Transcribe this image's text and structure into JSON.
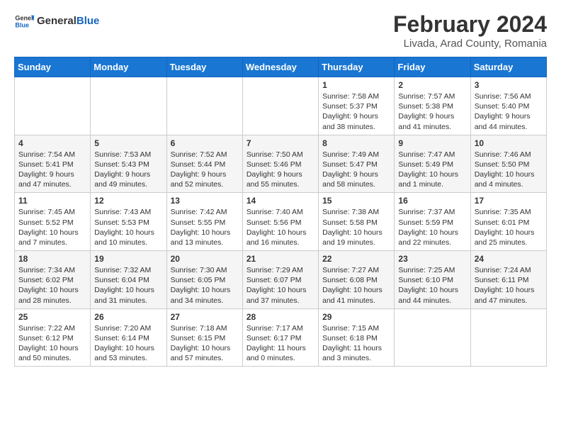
{
  "header": {
    "logo_general": "General",
    "logo_blue": "Blue",
    "main_title": "February 2024",
    "subtitle": "Livada, Arad County, Romania"
  },
  "days_of_week": [
    "Sunday",
    "Monday",
    "Tuesday",
    "Wednesday",
    "Thursday",
    "Friday",
    "Saturday"
  ],
  "weeks": [
    [
      {
        "day": "",
        "info": ""
      },
      {
        "day": "",
        "info": ""
      },
      {
        "day": "",
        "info": ""
      },
      {
        "day": "",
        "info": ""
      },
      {
        "day": "1",
        "info": "Sunrise: 7:58 AM\nSunset: 5:37 PM\nDaylight: 9 hours\nand 38 minutes."
      },
      {
        "day": "2",
        "info": "Sunrise: 7:57 AM\nSunset: 5:38 PM\nDaylight: 9 hours\nand 41 minutes."
      },
      {
        "day": "3",
        "info": "Sunrise: 7:56 AM\nSunset: 5:40 PM\nDaylight: 9 hours\nand 44 minutes."
      }
    ],
    [
      {
        "day": "4",
        "info": "Sunrise: 7:54 AM\nSunset: 5:41 PM\nDaylight: 9 hours\nand 47 minutes."
      },
      {
        "day": "5",
        "info": "Sunrise: 7:53 AM\nSunset: 5:43 PM\nDaylight: 9 hours\nand 49 minutes."
      },
      {
        "day": "6",
        "info": "Sunrise: 7:52 AM\nSunset: 5:44 PM\nDaylight: 9 hours\nand 52 minutes."
      },
      {
        "day": "7",
        "info": "Sunrise: 7:50 AM\nSunset: 5:46 PM\nDaylight: 9 hours\nand 55 minutes."
      },
      {
        "day": "8",
        "info": "Sunrise: 7:49 AM\nSunset: 5:47 PM\nDaylight: 9 hours\nand 58 minutes."
      },
      {
        "day": "9",
        "info": "Sunrise: 7:47 AM\nSunset: 5:49 PM\nDaylight: 10 hours\nand 1 minute."
      },
      {
        "day": "10",
        "info": "Sunrise: 7:46 AM\nSunset: 5:50 PM\nDaylight: 10 hours\nand 4 minutes."
      }
    ],
    [
      {
        "day": "11",
        "info": "Sunrise: 7:45 AM\nSunset: 5:52 PM\nDaylight: 10 hours\nand 7 minutes."
      },
      {
        "day": "12",
        "info": "Sunrise: 7:43 AM\nSunset: 5:53 PM\nDaylight: 10 hours\nand 10 minutes."
      },
      {
        "day": "13",
        "info": "Sunrise: 7:42 AM\nSunset: 5:55 PM\nDaylight: 10 hours\nand 13 minutes."
      },
      {
        "day": "14",
        "info": "Sunrise: 7:40 AM\nSunset: 5:56 PM\nDaylight: 10 hours\nand 16 minutes."
      },
      {
        "day": "15",
        "info": "Sunrise: 7:38 AM\nSunset: 5:58 PM\nDaylight: 10 hours\nand 19 minutes."
      },
      {
        "day": "16",
        "info": "Sunrise: 7:37 AM\nSunset: 5:59 PM\nDaylight: 10 hours\nand 22 minutes."
      },
      {
        "day": "17",
        "info": "Sunrise: 7:35 AM\nSunset: 6:01 PM\nDaylight: 10 hours\nand 25 minutes."
      }
    ],
    [
      {
        "day": "18",
        "info": "Sunrise: 7:34 AM\nSunset: 6:02 PM\nDaylight: 10 hours\nand 28 minutes."
      },
      {
        "day": "19",
        "info": "Sunrise: 7:32 AM\nSunset: 6:04 PM\nDaylight: 10 hours\nand 31 minutes."
      },
      {
        "day": "20",
        "info": "Sunrise: 7:30 AM\nSunset: 6:05 PM\nDaylight: 10 hours\nand 34 minutes."
      },
      {
        "day": "21",
        "info": "Sunrise: 7:29 AM\nSunset: 6:07 PM\nDaylight: 10 hours\nand 37 minutes."
      },
      {
        "day": "22",
        "info": "Sunrise: 7:27 AM\nSunset: 6:08 PM\nDaylight: 10 hours\nand 41 minutes."
      },
      {
        "day": "23",
        "info": "Sunrise: 7:25 AM\nSunset: 6:10 PM\nDaylight: 10 hours\nand 44 minutes."
      },
      {
        "day": "24",
        "info": "Sunrise: 7:24 AM\nSunset: 6:11 PM\nDaylight: 10 hours\nand 47 minutes."
      }
    ],
    [
      {
        "day": "25",
        "info": "Sunrise: 7:22 AM\nSunset: 6:12 PM\nDaylight: 10 hours\nand 50 minutes."
      },
      {
        "day": "26",
        "info": "Sunrise: 7:20 AM\nSunset: 6:14 PM\nDaylight: 10 hours\nand 53 minutes."
      },
      {
        "day": "27",
        "info": "Sunrise: 7:18 AM\nSunset: 6:15 PM\nDaylight: 10 hours\nand 57 minutes."
      },
      {
        "day": "28",
        "info": "Sunrise: 7:17 AM\nSunset: 6:17 PM\nDaylight: 11 hours\nand 0 minutes."
      },
      {
        "day": "29",
        "info": "Sunrise: 7:15 AM\nSunset: 6:18 PM\nDaylight: 11 hours\nand 3 minutes."
      },
      {
        "day": "",
        "info": ""
      },
      {
        "day": "",
        "info": ""
      }
    ]
  ]
}
